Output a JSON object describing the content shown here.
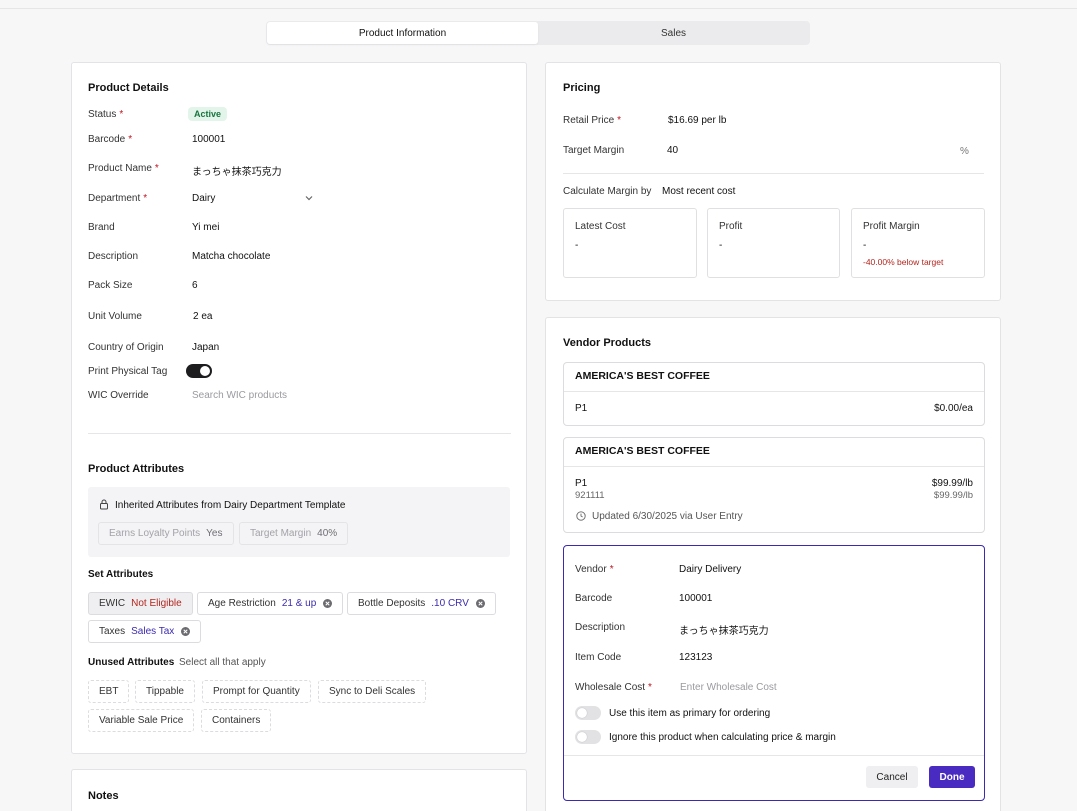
{
  "tabs": [
    "Product Information",
    "Sales"
  ],
  "product_details": {
    "title": "Product Details",
    "status_label": "Status",
    "status_value": "Active",
    "barcode_label": "Barcode",
    "barcode_value": "100001",
    "name_label": "Product Name",
    "name_value": "まっちゃ抹茶巧克力",
    "department_label": "Department",
    "department_value": "Dairy",
    "brand_label": "Brand",
    "brand_value": "Yi mei",
    "description_label": "Description",
    "description_value": "Matcha chocolate",
    "pack_label": "Pack Size",
    "pack_value": "6",
    "unit_label": "Unit Volume",
    "unit_value": "2 ea",
    "origin_label": "Country of Origin",
    "origin_value": "Japan",
    "print_label": "Print Physical Tag",
    "print_on": true,
    "wic_label": "WIC Override",
    "wic_placeholder": "Search WIC products"
  },
  "attributes": {
    "title": "Product Attributes",
    "inherited_title": "Inherited Attributes from Dairy Department Template",
    "inherited": [
      {
        "name": "Earns Loyalty Points",
        "value": "Yes"
      },
      {
        "name": "Target Margin",
        "value": "40%"
      }
    ],
    "set_title": "Set Attributes",
    "set": [
      {
        "name": "EWIC",
        "value": "Not Eligible"
      },
      {
        "name": "Age Restriction",
        "value": "21 & up"
      },
      {
        "name": "Bottle Deposits",
        "value": ".10 CRV"
      },
      {
        "name": "Taxes",
        "value": "Sales Tax"
      }
    ],
    "unused_title": "Unused Attributes",
    "unused_hint": "Select all that apply",
    "unused": [
      "EBT",
      "Tippable",
      "Prompt for Quantity",
      "Sync to Deli Scales",
      "Variable Sale Price",
      "Containers"
    ]
  },
  "notes": {
    "title": "Notes"
  },
  "pricing": {
    "title": "Pricing",
    "retail_label": "Retail Price",
    "retail_value": "$16.69 per lb",
    "margin_label": "Target Margin",
    "margin_value": "40",
    "margin_unit": "%",
    "calc_label": "Calculate Margin by",
    "calc_value": "Most recent cost",
    "cards": [
      {
        "label": "Latest Cost",
        "value": "-"
      },
      {
        "label": "Profit",
        "value": "-"
      },
      {
        "label": "Profit Margin",
        "value": "-",
        "note": "-40.00% below target"
      }
    ]
  },
  "vendors": {
    "title": "Vendor Products",
    "items": [
      {
        "name": "AMERICA'S BEST COFFEE",
        "code": "P1",
        "price": "$0.00/ea"
      },
      {
        "name": "AMERICA'S BEST COFFEE",
        "code": "P1",
        "sub": "921111",
        "price": "$99.99/lb",
        "price2": "$99.99/lb",
        "updated": "Updated 6/30/2025 via User Entry"
      }
    ],
    "form": {
      "vendor_label": "Vendor",
      "vendor_value": "Dairy Delivery",
      "barcode_label": "Barcode",
      "barcode_value": "100001",
      "description_label": "Description",
      "description_value": "まっちゃ抹茶巧克力",
      "item_code_label": "Item Code",
      "item_code_value": "123123",
      "wholesale_label": "Wholesale Cost",
      "wholesale_placeholder": "Enter Wholesale Cost",
      "primary_label": "Use this item as primary for ordering",
      "ignore_label": "Ignore this product when calculating price & margin",
      "cancel": "Cancel",
      "done": "Done"
    }
  }
}
